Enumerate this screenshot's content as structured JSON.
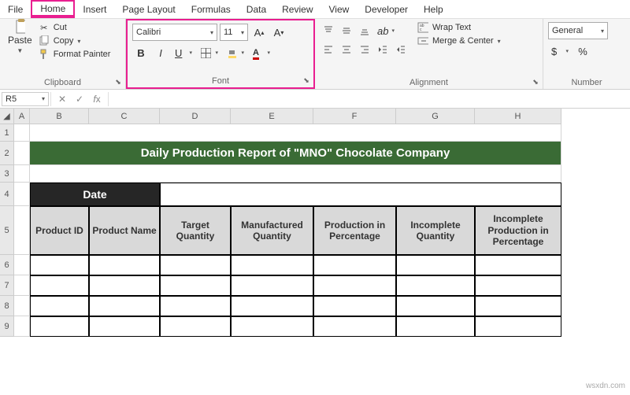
{
  "menu": {
    "items": [
      "File",
      "Home",
      "Insert",
      "Page Layout",
      "Formulas",
      "Data",
      "Review",
      "View",
      "Developer",
      "Help"
    ],
    "active": "Home"
  },
  "ribbon": {
    "clipboard": {
      "paste": "Paste",
      "cut": "Cut",
      "copy": "Copy",
      "format_painter": "Format Painter",
      "label": "Clipboard"
    },
    "font": {
      "name": "Calibri",
      "size": "11",
      "label": "Font"
    },
    "alignment": {
      "wrap": "Wrap Text",
      "merge": "Merge & Center",
      "label": "Alignment"
    },
    "number": {
      "format": "General",
      "label": "Number"
    }
  },
  "formula_bar": {
    "cell_ref": "R5",
    "value": ""
  },
  "sheet": {
    "columns": [
      "A",
      "B",
      "C",
      "D",
      "E",
      "F",
      "G",
      "H"
    ],
    "rows": [
      "1",
      "2",
      "3",
      "4",
      "5",
      "6",
      "7",
      "8",
      "9"
    ],
    "title": "Daily Production Report of \"MNO\" Chocolate Company",
    "date_label": "Date",
    "headers": [
      "Product ID",
      "Product Name",
      "Target Quantity",
      "Manufactured Quantity",
      "Production in Percentage",
      "Incomplete Quantity",
      "Incomplete Production in Percentage"
    ]
  },
  "watermark": "wsxdn.com"
}
